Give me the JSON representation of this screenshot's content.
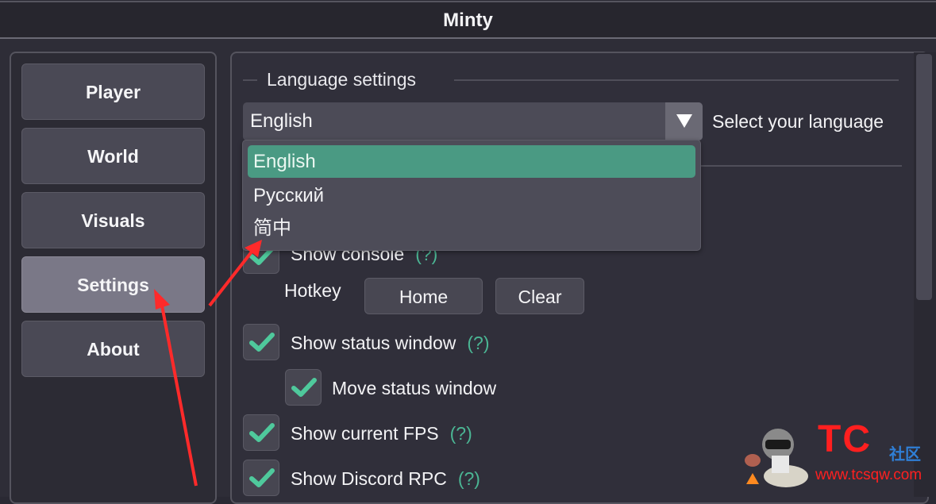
{
  "window": {
    "title": "Minty"
  },
  "sidebar": {
    "items": [
      {
        "label": "Player",
        "active": false
      },
      {
        "label": "World",
        "active": false
      },
      {
        "label": "Visuals",
        "active": false
      },
      {
        "label": "Settings",
        "active": true
      },
      {
        "label": "About",
        "active": false
      }
    ]
  },
  "language": {
    "section_title": "Language settings",
    "selected": "English",
    "caption": "Select your language",
    "options": [
      {
        "label": "English",
        "selected": true
      },
      {
        "label": "Русский",
        "selected": false
      },
      {
        "label": "简中",
        "selected": false
      }
    ]
  },
  "options": {
    "show_console": {
      "label": "Show console",
      "help": "(?)",
      "checked": true
    },
    "hotkey": {
      "label": "Hotkey",
      "value": "Home",
      "clear_label": "Clear"
    },
    "show_status_window": {
      "label": "Show status window",
      "help": "(?)",
      "checked": true
    },
    "move_status_window": {
      "label": "Move status window",
      "checked": true
    },
    "show_fps": {
      "label": "Show current FPS",
      "help": "(?)",
      "checked": true
    },
    "show_discord_rpc": {
      "label": "Show Discord RPC",
      "help": "(?)",
      "checked": true
    }
  },
  "watermark": {
    "brand": "TC",
    "brand_cn": "社区",
    "url": "www.tcsqw.com"
  },
  "colors": {
    "accent": "#4bb694",
    "selected_option": "#4a9a83",
    "annotation": "#ff2a2a"
  }
}
